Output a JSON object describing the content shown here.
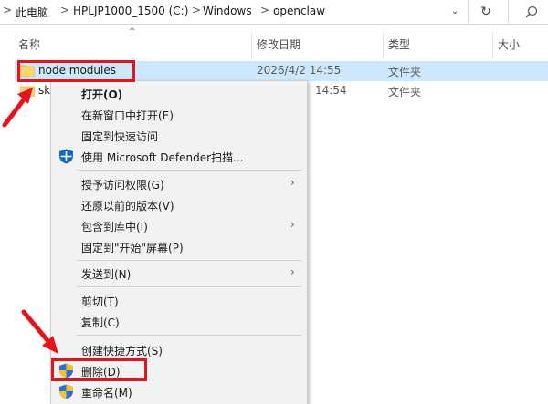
{
  "address": {
    "crumbs": [
      "此电脑",
      "HPLJP1000_1500 (C:)",
      "Windows",
      "openclaw"
    ],
    "separator": ">",
    "dropdown": "⌄",
    "refresh": "↻"
  },
  "columns": {
    "name": "名称",
    "date": "修改日期",
    "type": "类型",
    "size": "大小"
  },
  "files": [
    {
      "name": "node modules",
      "date": "2026/4/2 14:55",
      "type": "文件夹"
    },
    {
      "name": "sk",
      "date": "14:54",
      "type": "文件夹"
    }
  ],
  "menu": {
    "open": "打开(O)",
    "open_new_window": "在新窗口中打开(E)",
    "pin_quick_access": "固定到快速访问",
    "defender_scan": "使用 Microsoft Defender扫描...",
    "grant_access": "授予访问权限(G)",
    "restore_versions": "还原以前的版本(V)",
    "include_library": "包含到库中(I)",
    "pin_start": "固定到\"开始\"屏幕(P)",
    "send_to": "发送到(N)",
    "cut": "剪切(T)",
    "copy": "复制(C)",
    "create_shortcut": "创建快捷方式(S)",
    "delete": "删除(D)",
    "rename": "重命名(M)",
    "submenu_arrow": "›"
  },
  "colors": {
    "selection": "#cce8ff",
    "annotation_red": "#e8121a",
    "folder_yellow": "#f7d774"
  }
}
